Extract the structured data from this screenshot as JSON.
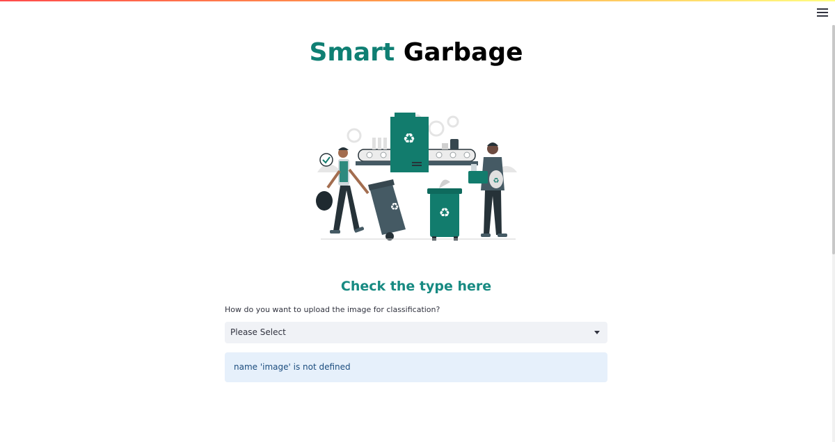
{
  "app": {
    "title_accent": "Smart",
    "title_rest": " Garbage",
    "menu_icon": "hamburger-menu-icon"
  },
  "hero": {
    "illustration": "recycling-workers-illustration",
    "colors": {
      "teal": "#127c6d",
      "dark": "#263238",
      "light_gray": "#e0e0e0"
    }
  },
  "main": {
    "subheading": "Check the type here",
    "select": {
      "label": "How do you want to upload the image for classification?",
      "value": "Please Select"
    },
    "alert": {
      "message": "name 'image' is not defined"
    }
  },
  "colors": {
    "accent": "#0f7f73",
    "subheading": "#178a82",
    "select_bg": "#f0f2f6",
    "alert_bg": "#e6f0fb",
    "alert_text": "#1b4c7e"
  }
}
